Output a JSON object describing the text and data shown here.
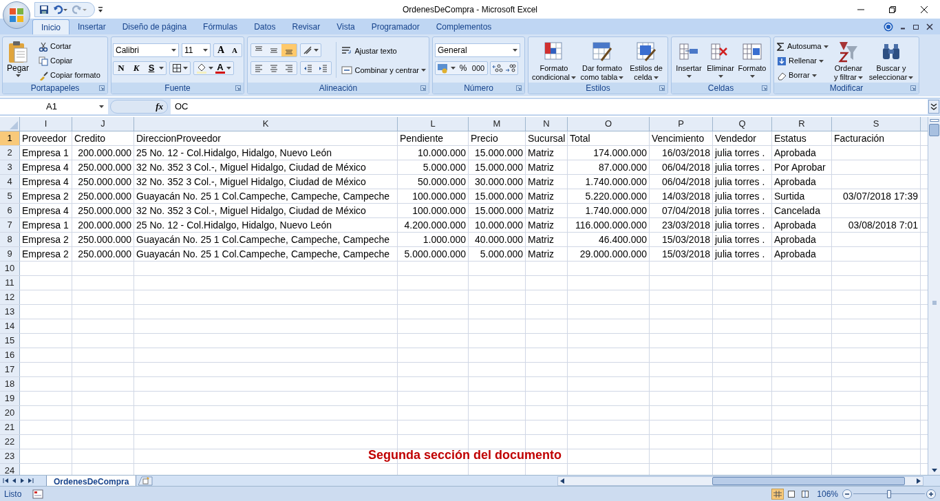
{
  "window": {
    "title": "OrdenesDeCompra - Microsoft Excel"
  },
  "ribbon_tabs": [
    {
      "label": "Inicio",
      "selected": true
    },
    {
      "label": "Insertar",
      "selected": false
    },
    {
      "label": "Diseño de página",
      "selected": false
    },
    {
      "label": "Fórmulas",
      "selected": false
    },
    {
      "label": "Datos",
      "selected": false
    },
    {
      "label": "Revisar",
      "selected": false
    },
    {
      "label": "Vista",
      "selected": false
    },
    {
      "label": "Programador",
      "selected": false
    },
    {
      "label": "Complementos",
      "selected": false
    }
  ],
  "clipboard": {
    "title": "Portapapeles",
    "paste": "Pegar",
    "items": [
      "Cortar",
      "Copiar",
      "Copiar formato"
    ]
  },
  "font": {
    "title": "Fuente",
    "family": "Calibri",
    "size": "11",
    "grow": "A",
    "shrink": "A",
    "bold": "N",
    "italic": "K",
    "underline": "S",
    "color_letter": "A"
  },
  "alignment": {
    "title": "Alineación",
    "wrap": "Ajustar texto",
    "merge": "Combinar y centrar"
  },
  "number": {
    "title": "Número",
    "format": "General",
    "percent": "%",
    "thousands": "000"
  },
  "styles": {
    "title": "Estilos",
    "buttons": [
      [
        "Formato",
        "condicional"
      ],
      [
        "Dar formato",
        "como tabla"
      ],
      [
        "Estilos de",
        "celda"
      ]
    ]
  },
  "cells": {
    "title": "Celdas",
    "buttons": [
      "Insertar",
      "Eliminar",
      "Formato"
    ]
  },
  "editing": {
    "title": "Modificar",
    "items": [
      "Autosuma",
      "Rellenar",
      "Borrar"
    ],
    "buttons": [
      [
        "Ordenar",
        "y filtrar"
      ],
      [
        "Buscar y",
        "seleccionar"
      ]
    ]
  },
  "formula_bar": {
    "name_box": "A1",
    "function_label": "fx",
    "value": "OC"
  },
  "sheet": {
    "columns": [
      {
        "letter": "I",
        "numeric": false
      },
      {
        "letter": "J",
        "numeric": true
      },
      {
        "letter": "K",
        "numeric": false
      },
      {
        "letter": "L",
        "numeric": true
      },
      {
        "letter": "M",
        "numeric": true
      },
      {
        "letter": "N",
        "numeric": false
      },
      {
        "letter": "O",
        "numeric": true
      },
      {
        "letter": "P",
        "numeric": true
      },
      {
        "letter": "Q",
        "numeric": false
      },
      {
        "letter": "R",
        "numeric": false
      },
      {
        "letter": "S",
        "numeric": true
      }
    ],
    "rows": [
      {
        "number": "1",
        "selected": true,
        "kind": "header",
        "cells": [
          "Proveedor",
          "Credito",
          "DireccionProveedor",
          "Pendiente",
          "Precio",
          "Sucursal",
          "Total",
          "Vencimiento",
          "Vendedor",
          "Estatus",
          "Facturación"
        ]
      },
      {
        "number": "2",
        "selected": false,
        "kind": "data",
        "cells": [
          "Empresa 1",
          "200.000.000",
          "25 No. 12 - Col.Hidalgo, Hidalgo, Nuevo León",
          "10.000.000",
          "15.000.000",
          "Matriz",
          "174.000.000",
          "16/03/2018",
          "julia torres .",
          "Aprobada",
          ""
        ]
      },
      {
        "number": "3",
        "selected": false,
        "kind": "data",
        "cells": [
          "Empresa 4",
          "250.000.000",
          "32 No. 352 3 Col.-, Miguel Hidalgo, Ciudad de México",
          "5.000.000",
          "15.000.000",
          "Matriz",
          "87.000.000",
          "06/04/2018",
          "julia torres .",
          "Por Aprobar",
          ""
        ]
      },
      {
        "number": "4",
        "selected": false,
        "kind": "data",
        "cells": [
          "Empresa 4",
          "250.000.000",
          "32 No. 352 3 Col.-, Miguel Hidalgo, Ciudad de México",
          "50.000.000",
          "30.000.000",
          "Matriz",
          "1.740.000.000",
          "06/04/2018",
          "julia torres .",
          "Aprobada",
          ""
        ]
      },
      {
        "number": "5",
        "selected": false,
        "kind": "data",
        "cells": [
          "Empresa 2",
          "250.000.000",
          "Guayacán No. 25 1 Col.Campeche, Campeche, Campeche",
          "100.000.000",
          "15.000.000",
          "Matriz",
          "5.220.000.000",
          "14/03/2018",
          "julia torres .",
          "Surtida",
          "03/07/2018 17:39"
        ]
      },
      {
        "number": "6",
        "selected": false,
        "kind": "data",
        "cells": [
          "Empresa 4",
          "250.000.000",
          "32 No. 352 3 Col.-, Miguel Hidalgo, Ciudad de México",
          "100.000.000",
          "15.000.000",
          "Matriz",
          "1.740.000.000",
          "07/04/2018",
          "julia torres .",
          "Cancelada",
          ""
        ]
      },
      {
        "number": "7",
        "selected": false,
        "kind": "data",
        "cells": [
          "Empresa 1",
          "200.000.000",
          "25 No. 12 - Col.Hidalgo, Hidalgo, Nuevo León",
          "4.200.000.000",
          "10.000.000",
          "Matriz",
          "116.000.000.000",
          "23/03/2018",
          "julia torres .",
          "Aprobada",
          "03/08/2018 7:01"
        ]
      },
      {
        "number": "8",
        "selected": false,
        "kind": "data",
        "cells": [
          "Empresa 2",
          "250.000.000",
          "Guayacán No. 25 1 Col.Campeche, Campeche, Campeche",
          "1.000.000",
          "40.000.000",
          "Matriz",
          "46.400.000",
          "15/03/2018",
          "julia torres .",
          "Aprobada",
          ""
        ]
      },
      {
        "number": "9",
        "selected": false,
        "kind": "data",
        "cells": [
          "Empresa 2",
          "250.000.000",
          "Guayacán No. 25 1 Col.Campeche, Campeche, Campeche",
          "5.000.000.000",
          "5.000.000",
          "Matriz",
          "29.000.000.000",
          "15/03/2018",
          "julia torres .",
          "Aprobada",
          ""
        ]
      },
      {
        "number": "10",
        "selected": false,
        "kind": "data",
        "cells": []
      },
      {
        "number": "11",
        "selected": false,
        "kind": "data",
        "cells": []
      },
      {
        "number": "12",
        "selected": false,
        "kind": "data",
        "cells": []
      },
      {
        "number": "13",
        "selected": false,
        "kind": "data",
        "cells": []
      },
      {
        "number": "14",
        "selected": false,
        "kind": "data",
        "cells": []
      },
      {
        "number": "15",
        "selected": false,
        "kind": "data",
        "cells": []
      },
      {
        "number": "16",
        "selected": false,
        "kind": "data",
        "cells": []
      },
      {
        "number": "17",
        "selected": false,
        "kind": "data",
        "cells": []
      },
      {
        "number": "18",
        "selected": false,
        "kind": "data",
        "cells": []
      },
      {
        "number": "19",
        "selected": false,
        "kind": "data",
        "cells": []
      },
      {
        "number": "20",
        "selected": false,
        "kind": "data",
        "cells": []
      },
      {
        "number": "21",
        "selected": false,
        "kind": "data",
        "cells": []
      },
      {
        "number": "22",
        "selected": false,
        "kind": "data",
        "cells": []
      },
      {
        "number": "23",
        "selected": false,
        "kind": "data",
        "cells": []
      },
      {
        "number": "24",
        "selected": false,
        "kind": "data",
        "cells": []
      }
    ],
    "overlay_text": "Segunda sección del documento"
  },
  "sheet_tabs": [
    {
      "label": "OrdenesDeCompra",
      "selected": true
    }
  ],
  "status_bar": {
    "status": "Listo",
    "zoom": "106%",
    "level": 0.5
  }
}
